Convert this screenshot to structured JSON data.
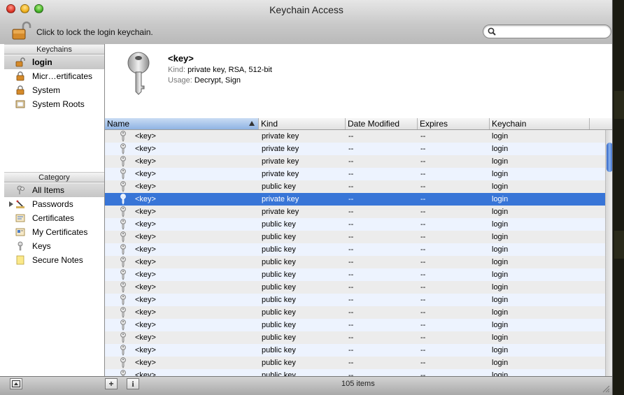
{
  "window": {
    "title": "Keychain Access"
  },
  "toolbar": {
    "lock_label": "Click to lock the login keychain.",
    "search_placeholder": ""
  },
  "sidebar": {
    "keychains_header": "Keychains",
    "keychains": [
      {
        "label": "login",
        "icon": "unlocked-padlock-icon",
        "selected": true
      },
      {
        "label": "Micr…ertificates",
        "icon": "padlock-icon"
      },
      {
        "label": "System",
        "icon": "padlock-icon"
      },
      {
        "label": "System Roots",
        "icon": "certificate-folder-icon"
      }
    ],
    "category_header": "Category",
    "categories": [
      {
        "label": "All Items",
        "icon": "all-items-icon",
        "selected": true
      },
      {
        "label": "Passwords",
        "icon": "passwords-icon",
        "expandable": true
      },
      {
        "label": "Certificates",
        "icon": "certificate-icon"
      },
      {
        "label": "My Certificates",
        "icon": "my-certificate-icon"
      },
      {
        "label": "Keys",
        "icon": "key-icon"
      },
      {
        "label": "Secure Notes",
        "icon": "secure-note-icon"
      }
    ]
  },
  "detail": {
    "name": "<key>",
    "kind_label": "Kind:",
    "kind_value": "private key, RSA, 512-bit",
    "usage_label": "Usage:",
    "usage_value": "Decrypt, Sign"
  },
  "table": {
    "columns": [
      "Name",
      "Kind",
      "Date Modified",
      "Expires",
      "Keychain"
    ],
    "sorted_column": "Name",
    "selected_index": 5,
    "rows": [
      {
        "name": "<key>",
        "kind": "private key",
        "modified": "--",
        "expires": "--",
        "keychain": "login"
      },
      {
        "name": "<key>",
        "kind": "private key",
        "modified": "--",
        "expires": "--",
        "keychain": "login"
      },
      {
        "name": "<key>",
        "kind": "private key",
        "modified": "--",
        "expires": "--",
        "keychain": "login"
      },
      {
        "name": "<key>",
        "kind": "private key",
        "modified": "--",
        "expires": "--",
        "keychain": "login"
      },
      {
        "name": "<key>",
        "kind": "public key",
        "modified": "--",
        "expires": "--",
        "keychain": "login"
      },
      {
        "name": "<key>",
        "kind": "private key",
        "modified": "--",
        "expires": "--",
        "keychain": "login"
      },
      {
        "name": "<key>",
        "kind": "private key",
        "modified": "--",
        "expires": "--",
        "keychain": "login"
      },
      {
        "name": "<key>",
        "kind": "public key",
        "modified": "--",
        "expires": "--",
        "keychain": "login"
      },
      {
        "name": "<key>",
        "kind": "public key",
        "modified": "--",
        "expires": "--",
        "keychain": "login"
      },
      {
        "name": "<key>",
        "kind": "public key",
        "modified": "--",
        "expires": "--",
        "keychain": "login"
      },
      {
        "name": "<key>",
        "kind": "public key",
        "modified": "--",
        "expires": "--",
        "keychain": "login"
      },
      {
        "name": "<key>",
        "kind": "public key",
        "modified": "--",
        "expires": "--",
        "keychain": "login"
      },
      {
        "name": "<key>",
        "kind": "public key",
        "modified": "--",
        "expires": "--",
        "keychain": "login"
      },
      {
        "name": "<key>",
        "kind": "public key",
        "modified": "--",
        "expires": "--",
        "keychain": "login"
      },
      {
        "name": "<key>",
        "kind": "public key",
        "modified": "--",
        "expires": "--",
        "keychain": "login"
      },
      {
        "name": "<key>",
        "kind": "public key",
        "modified": "--",
        "expires": "--",
        "keychain": "login"
      },
      {
        "name": "<key>",
        "kind": "public key",
        "modified": "--",
        "expires": "--",
        "keychain": "login"
      },
      {
        "name": "<key>",
        "kind": "public key",
        "modified": "--",
        "expires": "--",
        "keychain": "login"
      },
      {
        "name": "<key>",
        "kind": "public key",
        "modified": "--",
        "expires": "--",
        "keychain": "login"
      },
      {
        "name": "<key>",
        "kind": "public key",
        "modified": "--",
        "expires": "--",
        "keychain": "login"
      }
    ]
  },
  "status": {
    "add_label": "+",
    "info_label": "i",
    "item_count": "105 items"
  },
  "colors": {
    "selection": "#3875d7",
    "alt_row": "#edf3fe",
    "sorted_header": "#8fb3e3"
  }
}
